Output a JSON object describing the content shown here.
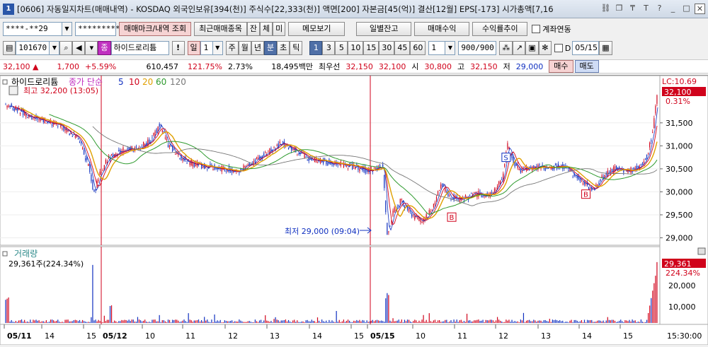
{
  "window": {
    "number": "1",
    "title": "[0606] 자동일지차트(매매내역) - KOSDAQ 외국인보유[394(천)] 주식수[22,333(천)] 액면[200] 자본금[45(억)] 결산[12월] EPS[-173] 시가총액[7,16"
  },
  "toolbar1": {
    "account": "****-**29",
    "password": "*********",
    "trade_mark_btn": "매매마크/내역 조회",
    "recent_btn": "최근매매종목",
    "jan_btn": "잔",
    "che_btn": "체",
    "mi_btn": "미",
    "memo_btn": "메모보기",
    "daily_balance_btn": "일별잔고",
    "trade_profit_btn": "매매수익",
    "yield_btn": "수익률추이",
    "account_link_label": "계좌연동"
  },
  "toolbar2": {
    "code": "101670",
    "name_tag": "종",
    "stock_name": "하이드로리튬",
    "warn": "!",
    "period_label": "일",
    "period_num": "1",
    "week": "주",
    "month": "월",
    "year": "년",
    "minute": "분",
    "second": "초",
    "tick": "틱",
    "intervals": [
      "1",
      "3",
      "5",
      "10",
      "15",
      "30",
      "45",
      "60"
    ],
    "count_value": "1",
    "bar_count": "900/900",
    "d_label": "D",
    "date_value": "05/15"
  },
  "quote": {
    "price": "32,100",
    "change": "1,700",
    "change_pct": "+5.59%",
    "volume": "610,457",
    "vol_ratio": "121.75%",
    "turnover": "2.73%",
    "amount": "18,495백만",
    "pref_label": "최우선",
    "ask": "32,150",
    "bid": "32,100",
    "open_label": "시",
    "open": "30,800",
    "high_label": "고",
    "high": "32,150",
    "low_label": "저",
    "low": "29,000",
    "buy_btn": "매수",
    "sell_btn": "매도"
  },
  "price_panel": {
    "stock_label": "하이드로리튬",
    "ma_label": "종가 단순",
    "ma_periods": [
      "5",
      "10",
      "20",
      "60",
      "120"
    ],
    "high_note": "최고 32,200 (13:05)",
    "low_note": "최저 29,000 (09:04)",
    "lc_label": "LC:10.69",
    "last_price_tag": "32,100",
    "last_pct_tag": "0.31%",
    "y_ticks": [
      "31,500",
      "31,000",
      "30,500",
      "30,000",
      "29,500",
      "29,000"
    ],
    "marker_buy": "B",
    "marker_sell": "S"
  },
  "volume_panel": {
    "title": "거래량",
    "value_text": "29,361주(224.34%)",
    "last_tag": "29,361",
    "last_pct_tag": "224.34%",
    "y_ticks": [
      "20,000",
      "10,000"
    ]
  },
  "x_axis": {
    "labels": [
      "05/11",
      "14",
      "15",
      "05/12",
      "10",
      "11",
      "12",
      "13",
      "14",
      "15",
      "05/15",
      "10",
      "11",
      "12",
      "13",
      "14",
      "15"
    ],
    "time_label": "15:30:00"
  },
  "colors": {
    "up": "#d0021b",
    "down": "#1030c0",
    "ma5": "#1030c0",
    "ma10": "#d0021b",
    "ma20": "#e0a000",
    "ma60": "#2e9a2e",
    "ma120": "#777777"
  },
  "chart_data": {
    "type": "candlestick",
    "price_axis_range": [
      28900,
      32250
    ],
    "key_points": {
      "high": 32200,
      "low": 29000,
      "last": 32100
    },
    "price_path": [
      [
        0,
        31900
      ],
      [
        20,
        31750
      ],
      [
        40,
        31600
      ],
      [
        60,
        31500
      ],
      [
        80,
        31400
      ],
      [
        100,
        31150
      ],
      [
        115,
        30550
      ],
      [
        122,
        29950
      ],
      [
        130,
        30400
      ],
      [
        140,
        30700
      ],
      [
        160,
        30900
      ],
      [
        180,
        30950
      ],
      [
        200,
        31100
      ],
      [
        212,
        31450
      ],
      [
        225,
        31000
      ],
      [
        240,
        30750
      ],
      [
        260,
        30600
      ],
      [
        280,
        30550
      ],
      [
        300,
        30500
      ],
      [
        320,
        30450
      ],
      [
        340,
        30600
      ],
      [
        360,
        30850
      ],
      [
        380,
        31050
      ],
      [
        400,
        30900
      ],
      [
        420,
        30700
      ],
      [
        440,
        30650
      ],
      [
        460,
        30600
      ],
      [
        480,
        30550
      ],
      [
        500,
        30450
      ],
      [
        520,
        30550
      ],
      [
        526,
        29050
      ],
      [
        535,
        29600
      ],
      [
        545,
        29800
      ],
      [
        560,
        29500
      ],
      [
        575,
        29350
      ],
      [
        590,
        29700
      ],
      [
        600,
        30200
      ],
      [
        612,
        29900
      ],
      [
        630,
        29850
      ],
      [
        650,
        29950
      ],
      [
        670,
        29950
      ],
      [
        685,
        30300
      ],
      [
        692,
        31000
      ],
      [
        700,
        30650
      ],
      [
        712,
        30450
      ],
      [
        730,
        30550
      ],
      [
        750,
        30500
      ],
      [
        765,
        30600
      ],
      [
        780,
        30400
      ],
      [
        795,
        30200
      ],
      [
        810,
        30050
      ],
      [
        825,
        30350
      ],
      [
        840,
        30500
      ],
      [
        860,
        30450
      ],
      [
        875,
        30550
      ],
      [
        885,
        30800
      ],
      [
        892,
        31300
      ],
      [
        898,
        32100
      ]
    ],
    "markers": [
      {
        "type": "B",
        "x_index": 615,
        "price": 29450
      },
      {
        "type": "S",
        "x_index": 690,
        "price": 30750
      },
      {
        "type": "B",
        "x_index": 800,
        "price": 29950
      }
    ],
    "volume_axis_range": [
      0,
      30000
    ],
    "volume_last": 29361
  }
}
